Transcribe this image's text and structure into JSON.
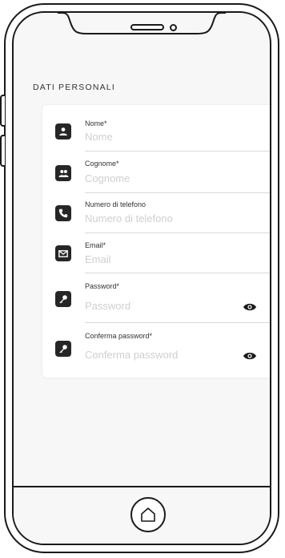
{
  "section_title": "Dati personali",
  "fields": [
    {
      "label": "Nome*",
      "placeholder": "Nome",
      "icon": "person-icon"
    },
    {
      "label": "Cognome*",
      "placeholder": "Cognome",
      "icon": "people-icon"
    },
    {
      "label": "Numero di telefono",
      "placeholder": "Numero di telefono",
      "icon": "phone-icon"
    },
    {
      "label": "Email*",
      "placeholder": "Email",
      "icon": "envelope-icon"
    },
    {
      "label": "Password*",
      "placeholder": "Password",
      "icon": "key-icon"
    },
    {
      "label": "Conferma password*",
      "placeholder": "Conferma password",
      "icon": "key-icon"
    }
  ],
  "eye_icon": "eye-icon",
  "home_icon": "home-icon"
}
